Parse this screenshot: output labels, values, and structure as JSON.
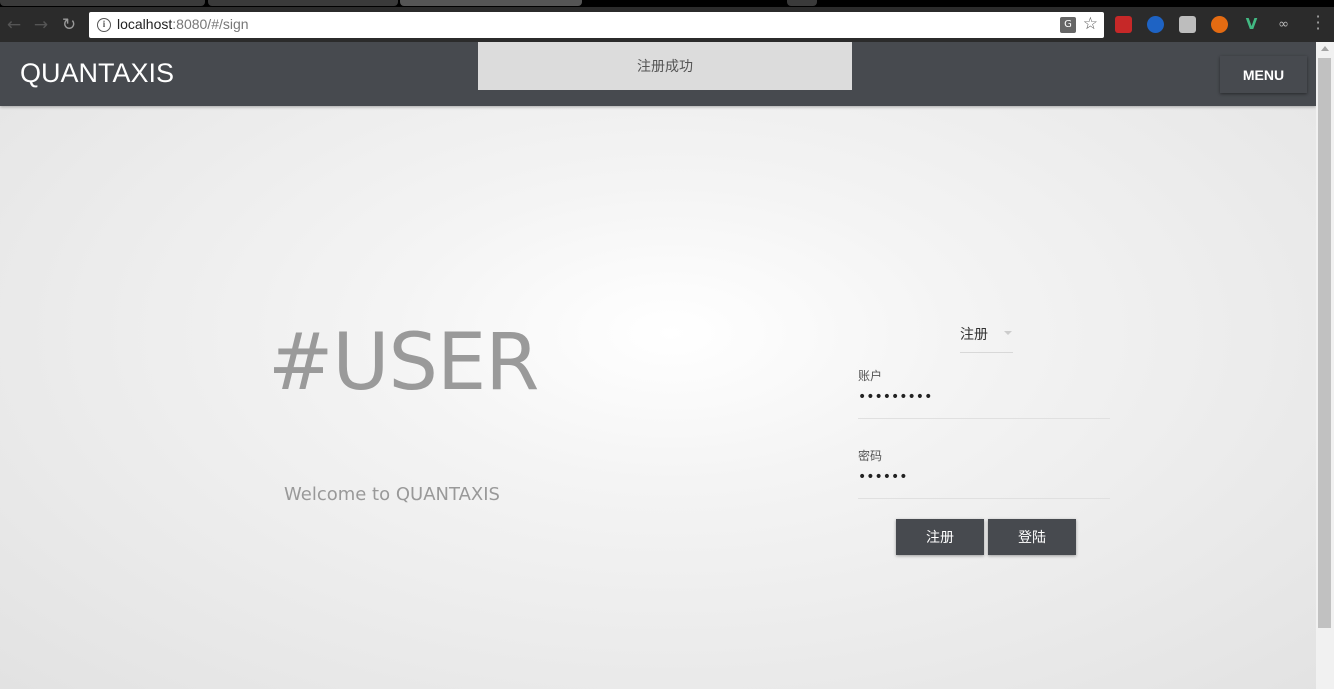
{
  "browser": {
    "url_host": "localhost",
    "url_rest": ":8080/#/sign"
  },
  "app": {
    "brand": "QUANTAXIS",
    "menu_label": "MENU",
    "toast": "注册成功"
  },
  "hero": {
    "title": "#USER",
    "subtitle": "Welcome to QUANTAXIS"
  },
  "form": {
    "mode": "注册",
    "account_label": "账户",
    "account_value": "•••••••••",
    "password_label": "密码",
    "password_value": "••••••",
    "register_label": "注册",
    "login_label": "登陆"
  },
  "colors": {
    "appbar": "#474a4f",
    "toast_bg": "#dcdcdc"
  }
}
